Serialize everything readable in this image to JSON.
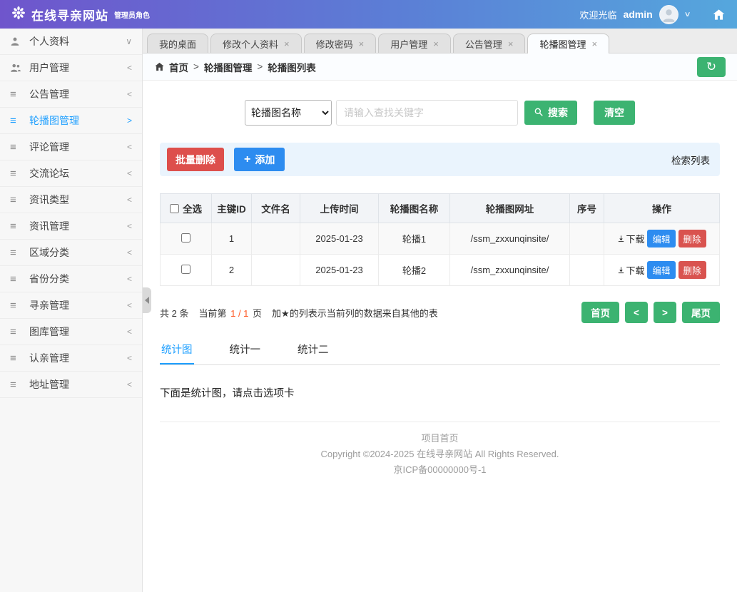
{
  "header": {
    "brand_title": "在线寻亲网站",
    "brand_subtitle": "管理员角色",
    "welcome_text": "欢迎光临",
    "username": "admin"
  },
  "glyphs": {
    "close": "×",
    "list_icon": "≡",
    "caret_down": "∨",
    "breadcrumb_sep": ">",
    "refresh": "↻",
    "plus": "+"
  },
  "colors": {
    "header_gradient_start": "#6f55cc",
    "header_gradient_end": "#55a7dd",
    "green": "#3cb371",
    "blue": "#2d8cf0",
    "red": "#d9534f",
    "active_blue": "#1e9fff"
  },
  "sidebar": {
    "items": [
      {
        "label": "个人资料",
        "chevron": "∨"
      },
      {
        "label": "用户管理",
        "chevron": "<"
      },
      {
        "label": "公告管理",
        "chevron": "<"
      },
      {
        "label": "轮播图管理",
        "chevron": ">",
        "active": true
      },
      {
        "label": "评论管理",
        "chevron": "<"
      },
      {
        "label": "交流论坛",
        "chevron": "<"
      },
      {
        "label": "资讯类型",
        "chevron": "<"
      },
      {
        "label": "资讯管理",
        "chevron": "<"
      },
      {
        "label": "区域分类",
        "chevron": "<"
      },
      {
        "label": "省份分类",
        "chevron": "<"
      },
      {
        "label": "寻亲管理",
        "chevron": "<"
      },
      {
        "label": "图库管理",
        "chevron": "<"
      },
      {
        "label": "认亲管理",
        "chevron": "<"
      },
      {
        "label": "地址管理",
        "chevron": "<"
      }
    ]
  },
  "tabs": [
    {
      "label": "我的桌面",
      "closable": false
    },
    {
      "label": "修改个人资料",
      "closable": true
    },
    {
      "label": "修改密码",
      "closable": true
    },
    {
      "label": "用户管理",
      "closable": true
    },
    {
      "label": "公告管理",
      "closable": true
    },
    {
      "label": "轮播图管理",
      "closable": true,
      "active": true
    }
  ],
  "breadcrumb": {
    "items": [
      "首页",
      "轮播图管理",
      "轮播图列表"
    ]
  },
  "search": {
    "field_option": "轮播图名称",
    "placeholder": "请输入查找关键字",
    "search_label": "搜索",
    "clear_label": "清空"
  },
  "actions": {
    "batch_delete_label": "批量删除",
    "add_label": "添加",
    "panel_right_label": "检索列表"
  },
  "table": {
    "headers": [
      "全选",
      "主键ID",
      "文件名",
      "上传时间",
      "轮播图名称",
      "轮播图网址",
      "序号",
      "操作"
    ],
    "ops": {
      "download": "下载",
      "edit": "编辑",
      "delete": "删除"
    },
    "rows": [
      {
        "id": "1",
        "file": "",
        "time": "2025-01-23",
        "name": "轮播1",
        "url": "/ssm_zxxunqinsite/",
        "seq": ""
      },
      {
        "id": "2",
        "file": "",
        "time": "2025-01-23",
        "name": "轮播2",
        "url": "/ssm_zxxunqinsite/",
        "seq": ""
      }
    ]
  },
  "pagination": {
    "total": "共 2 条",
    "current_prefix": "当前第",
    "page_indicator": "1 / 1",
    "page_suffix": "页",
    "note": "加★的列表示当前列的数据来自其他的表",
    "first": "首页",
    "prev": "<",
    "next": ">",
    "last": "尾页"
  },
  "stats": {
    "tabs": [
      {
        "label": "统计图",
        "active": true
      },
      {
        "label": "统计一"
      },
      {
        "label": "统计二"
      }
    ],
    "hint": "下面是统计图，请点击选项卡"
  },
  "footer": {
    "home_link": "项目首页",
    "copyright": "Copyright ©2024-2025 在线寻亲网站 All Rights Reserved.",
    "icp": "京ICP备00000000号-1"
  }
}
